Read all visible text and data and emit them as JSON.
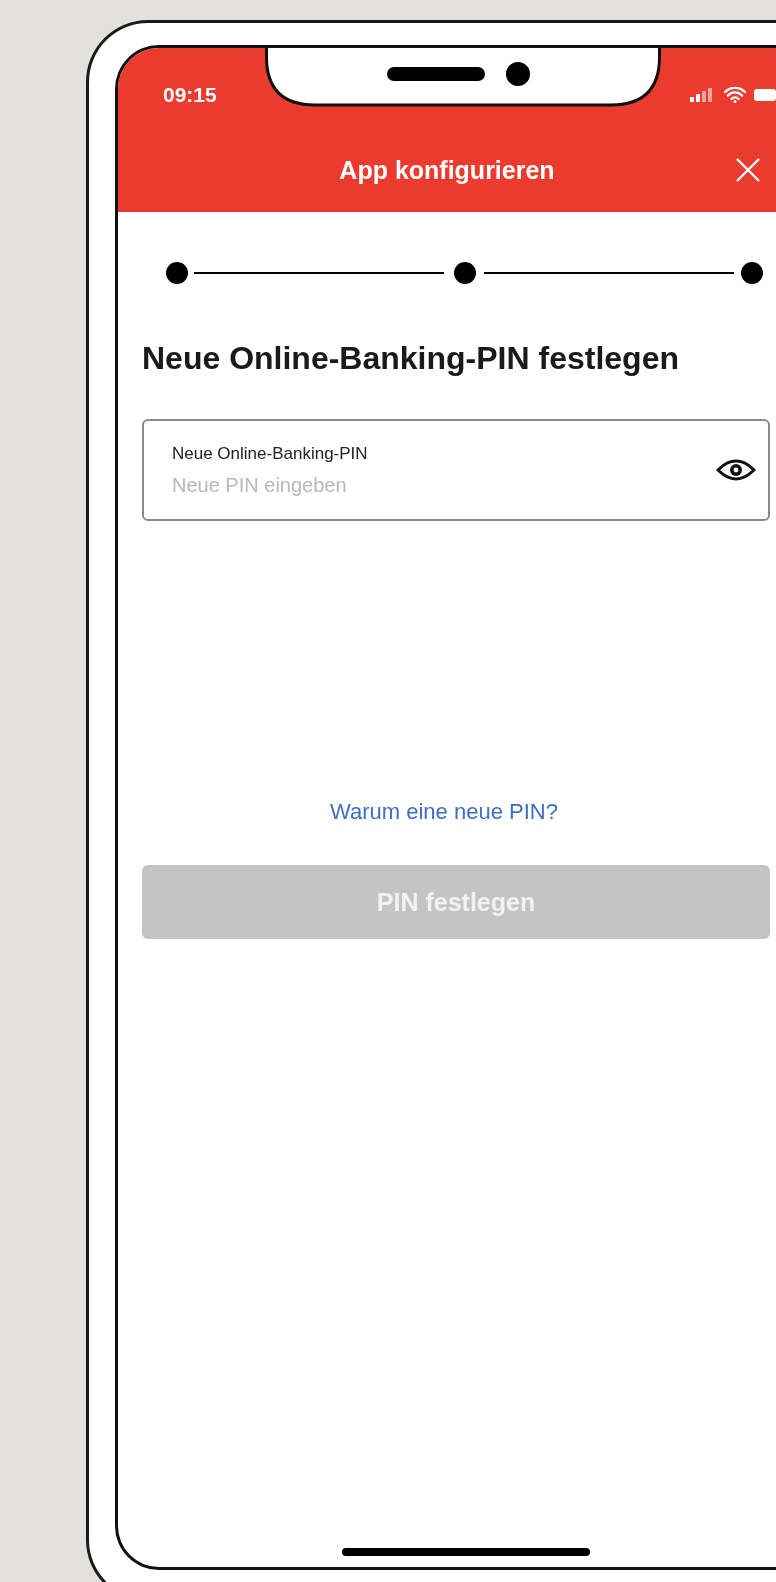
{
  "status_bar": {
    "time": "09:15"
  },
  "header": {
    "title": "App konfigurieren"
  },
  "heading": "Neue Online-Banking-PIN festlegen",
  "pin_field": {
    "label": "Neue Online-Banking-PIN",
    "placeholder": "Neue PIN eingeben"
  },
  "help_link": "Warum eine neue PIN?",
  "submit_button": {
    "label": "PIN festlegen",
    "disabled": true
  }
}
